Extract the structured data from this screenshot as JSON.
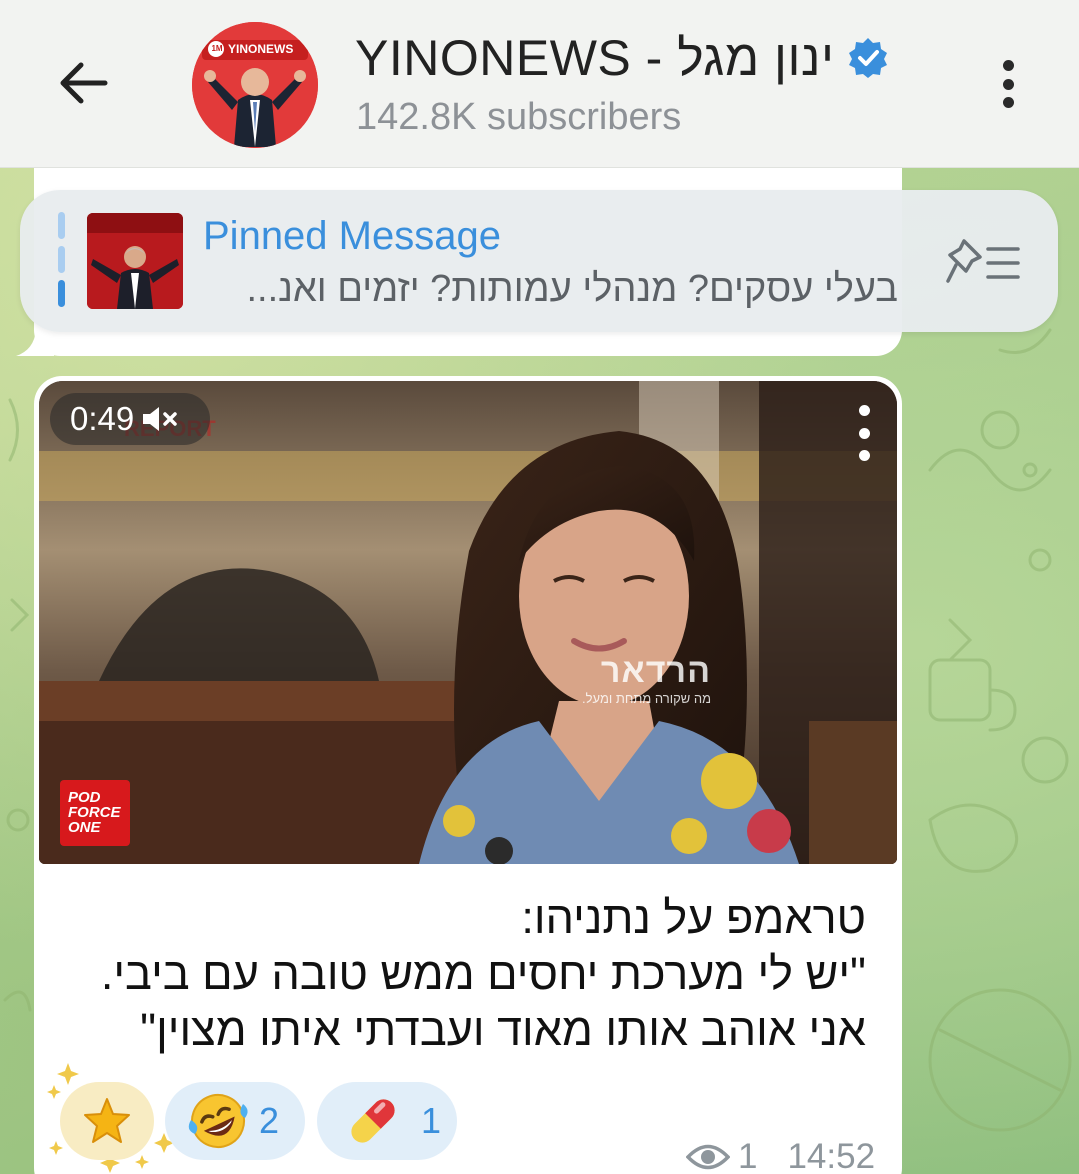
{
  "header": {
    "channel_name": "YINONEWS - ינון מגל",
    "subscribers": "142.8K subscribers",
    "avatar_badge": "YINONEWS",
    "avatar_badge_count": "1M",
    "verified": true
  },
  "pinned": {
    "title": "Pinned Message",
    "text": "בעלי עסקים? מנהלי עמותות? יזמים ואנ..."
  },
  "message": {
    "video": {
      "duration": "0:49",
      "muted": true,
      "logo_badge": "POD FORCE ONE",
      "watermark": "הרדאר",
      "watermark_tagline": "מה שקורה מתחת ומעל."
    },
    "caption_lines": [
      "טראמפ על נתניהו:",
      "\"יש לי מערכת יחסים ממש טובה עם ביבי.",
      "אני אוהב אותו מאוד ועבדתי איתו מצוין\""
    ],
    "reactions": [
      {
        "emoji": "star",
        "count": ""
      },
      {
        "emoji": "rofl-face",
        "count": "2"
      },
      {
        "emoji": "pill",
        "count": "1"
      }
    ],
    "views": "1",
    "time": "14:52"
  },
  "colors": {
    "accent": "#3a8fdc",
    "header_bg": "#f2f3f1",
    "reaction_bg": "#e1eef9"
  }
}
